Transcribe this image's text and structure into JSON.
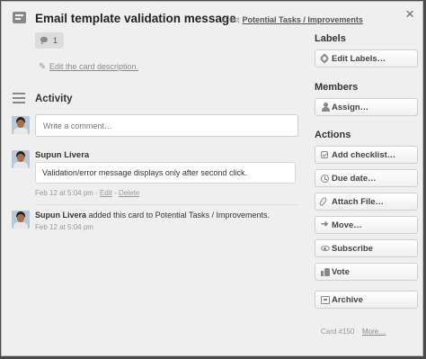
{
  "card": {
    "title": "Email template validation message",
    "list_prefix": "in list",
    "list_name": "Potential Tasks / Improvements",
    "comment_count": "1",
    "edit_description": "Edit the card description.",
    "card_number": "Card #150",
    "more_link": "More…"
  },
  "activity": {
    "title": "Activity",
    "comment_placeholder": "Write a comment…",
    "entries": [
      {
        "author": "Supun Livera",
        "comment": "Validation/error message displays only after second click.",
        "timestamp": "Feb 12 at 5:04 pm",
        "edit_label": "Edit",
        "delete_label": "Delete"
      },
      {
        "author": "Supun Livera",
        "action_text": "added this card to Potential Tasks / Improvements.",
        "timestamp": "Feb 12 at 5:04 pm"
      }
    ]
  },
  "sidebar": {
    "labels_title": "Labels",
    "members_title": "Members",
    "actions_title": "Actions",
    "edit_labels": "Edit Labels…",
    "assign": "Assign…",
    "actions": [
      {
        "label": "Add checklist…",
        "icon": "checklist-icon"
      },
      {
        "label": "Due date…",
        "icon": "clock-icon"
      },
      {
        "label": "Attach File…",
        "icon": "paperclip-icon"
      },
      {
        "label": "Move…",
        "icon": "arrow-right-icon"
      },
      {
        "label": "Subscribe",
        "icon": "eye-icon"
      },
      {
        "label": "Vote",
        "icon": "thumbs-up-icon"
      },
      {
        "label": "Archive",
        "icon": "archive-icon"
      }
    ]
  },
  "colors": {
    "background": "#efefef",
    "backdrop": "#4a4a4a",
    "button_border": "#cfcfcf",
    "muted_text": "#999999"
  }
}
